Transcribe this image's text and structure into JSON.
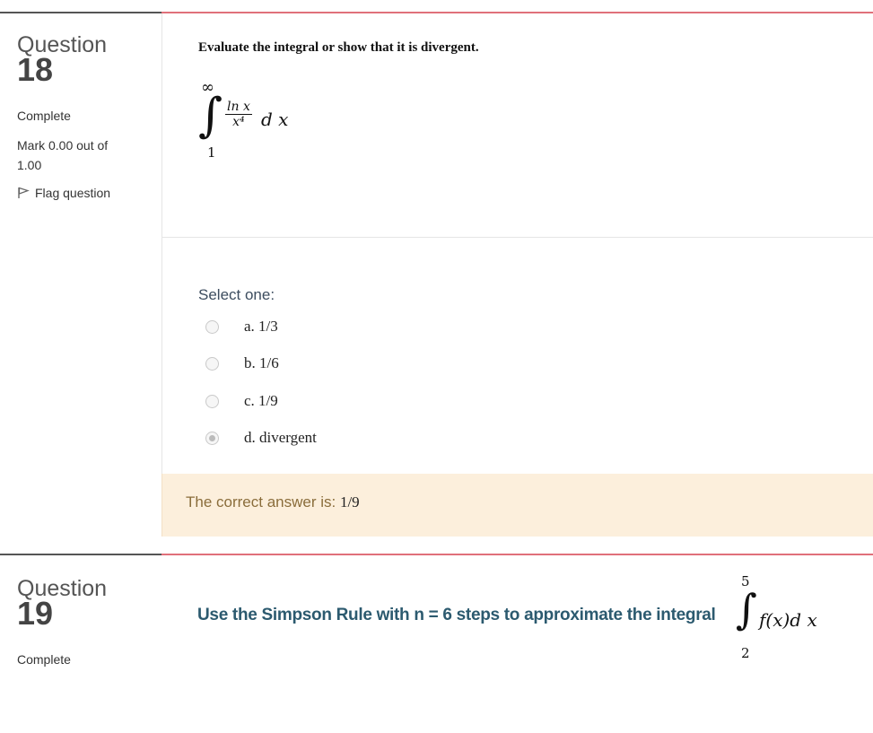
{
  "question18": {
    "label": "Question",
    "number": "18",
    "state": "Complete",
    "grade": "Mark 0.00 out of 1.00",
    "flag": "Flag question",
    "text": "Evaluate the integral or show that it is divergent.",
    "integral": {
      "upper": "∞",
      "lower": "1",
      "numerator": "ln x",
      "denominator": "x⁴",
      "differential": "d x"
    },
    "prompt": "Select one:",
    "options": [
      {
        "label": "a. 1/3",
        "selected": false
      },
      {
        "label": "b. 1/6",
        "selected": false
      },
      {
        "label": "c. 1/9",
        "selected": false
      },
      {
        "label": "d. divergent",
        "selected": true
      }
    ],
    "feedback_label": "The correct answer is: ",
    "feedback_value": "1/9"
  },
  "question19": {
    "label": "Question",
    "number": "19",
    "state": "Complete",
    "text": "Use the Simpson Rule with n = 6 steps to approximate the integral",
    "integral": {
      "upper": "5",
      "lower": "2",
      "expression": "f(x)d x"
    }
  },
  "colors": {
    "accent_rule": "#e0707a",
    "feedback_bg": "#fcefdc",
    "question_text": "#2c5a6f"
  }
}
